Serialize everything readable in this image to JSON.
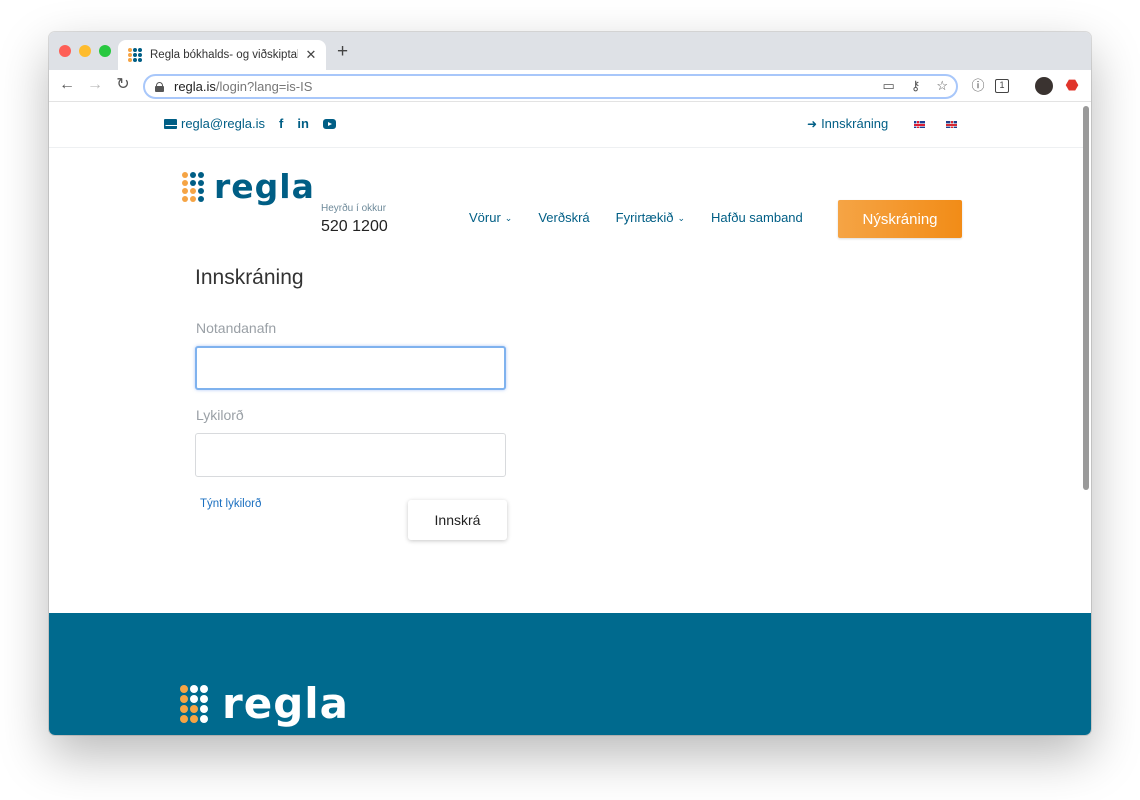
{
  "browser": {
    "tab_title": "Regla bókhalds- og viðskiptaku",
    "url_domain": "regla.is",
    "url_path": "/login?lang=is-IS"
  },
  "topbar": {
    "email": "regla@regla.is",
    "facebook": "f",
    "linkedin": "in",
    "login_link": "Innskráning"
  },
  "header": {
    "logo": "regla",
    "phone_label": "Heyrðu í okkur",
    "phone_number": "520 1200",
    "nav": {
      "products": "Vörur",
      "pricing": "Verðskrá",
      "company": "Fyrirtækið",
      "contact": "Hafðu samband"
    },
    "signup_button": "Nýskráning"
  },
  "form": {
    "title": "Innskráning",
    "username_label": "Notandanafn",
    "username_value": "",
    "password_label": "Lykilorð",
    "password_value": "",
    "forgot_link": "Týnt lykilorð",
    "submit_button": "Innskrá"
  },
  "footer": {
    "logo": "regla"
  },
  "colors": {
    "brand_blue": "#005e85",
    "footer_blue": "#006a8e",
    "accent_orange": "#f28c17"
  }
}
